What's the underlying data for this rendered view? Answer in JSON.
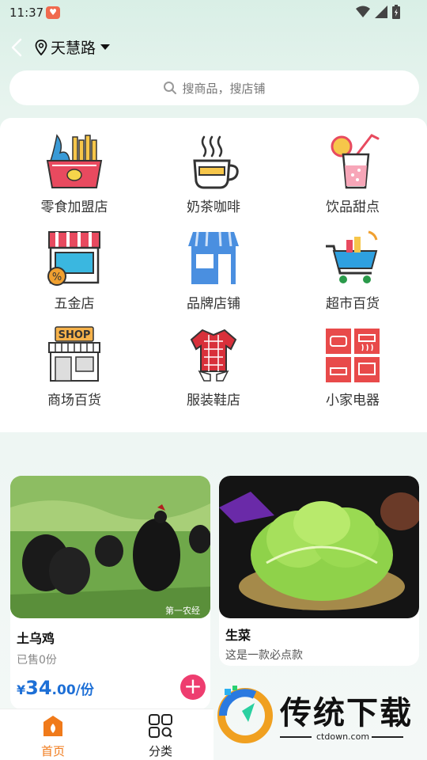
{
  "status_bar": {
    "time": "11:37",
    "app_icon": "heart-app-icon",
    "icons": [
      "wifi-icon",
      "signal-icon",
      "battery-icon"
    ]
  },
  "header": {
    "location": "天慧路"
  },
  "search": {
    "placeholder": "搜商品，搜店铺"
  },
  "categories": [
    {
      "label": "零食加盟店",
      "icon": "snack-basket-icon"
    },
    {
      "label": "奶茶咖啡",
      "icon": "coffee-cup-icon"
    },
    {
      "label": "饮品甜点",
      "icon": "drink-icon"
    },
    {
      "label": "五金店",
      "icon": "storefront-discount-icon"
    },
    {
      "label": "品牌店铺",
      "icon": "brand-store-icon"
    },
    {
      "label": "超市百货",
      "icon": "shopping-cart-icon"
    },
    {
      "label": "商场百货",
      "icon": "shop-building-icon"
    },
    {
      "label": "服装鞋店",
      "icon": "clothing-icon"
    },
    {
      "label": "小家电器",
      "icon": "appliances-icon"
    }
  ],
  "products": [
    {
      "name": "土乌鸡",
      "sold": "已售0份",
      "price_currency": "¥",
      "price_int": "34",
      "price_dec": ".00/份",
      "image_caption": "第一农经"
    },
    {
      "name": "生菜",
      "desc": "这是一款必点款"
    }
  ],
  "bottom_nav": [
    {
      "label": "首页",
      "icon": "home-icon",
      "active": true
    },
    {
      "label": "分类",
      "icon": "category-grid-icon",
      "active": false
    }
  ],
  "watermark": {
    "text": "传统下载",
    "url": "ctdown.com"
  },
  "colors": {
    "price": "#1d6fd6",
    "add_button": "#ee3d6f",
    "nav_active": "#f07a1a"
  }
}
